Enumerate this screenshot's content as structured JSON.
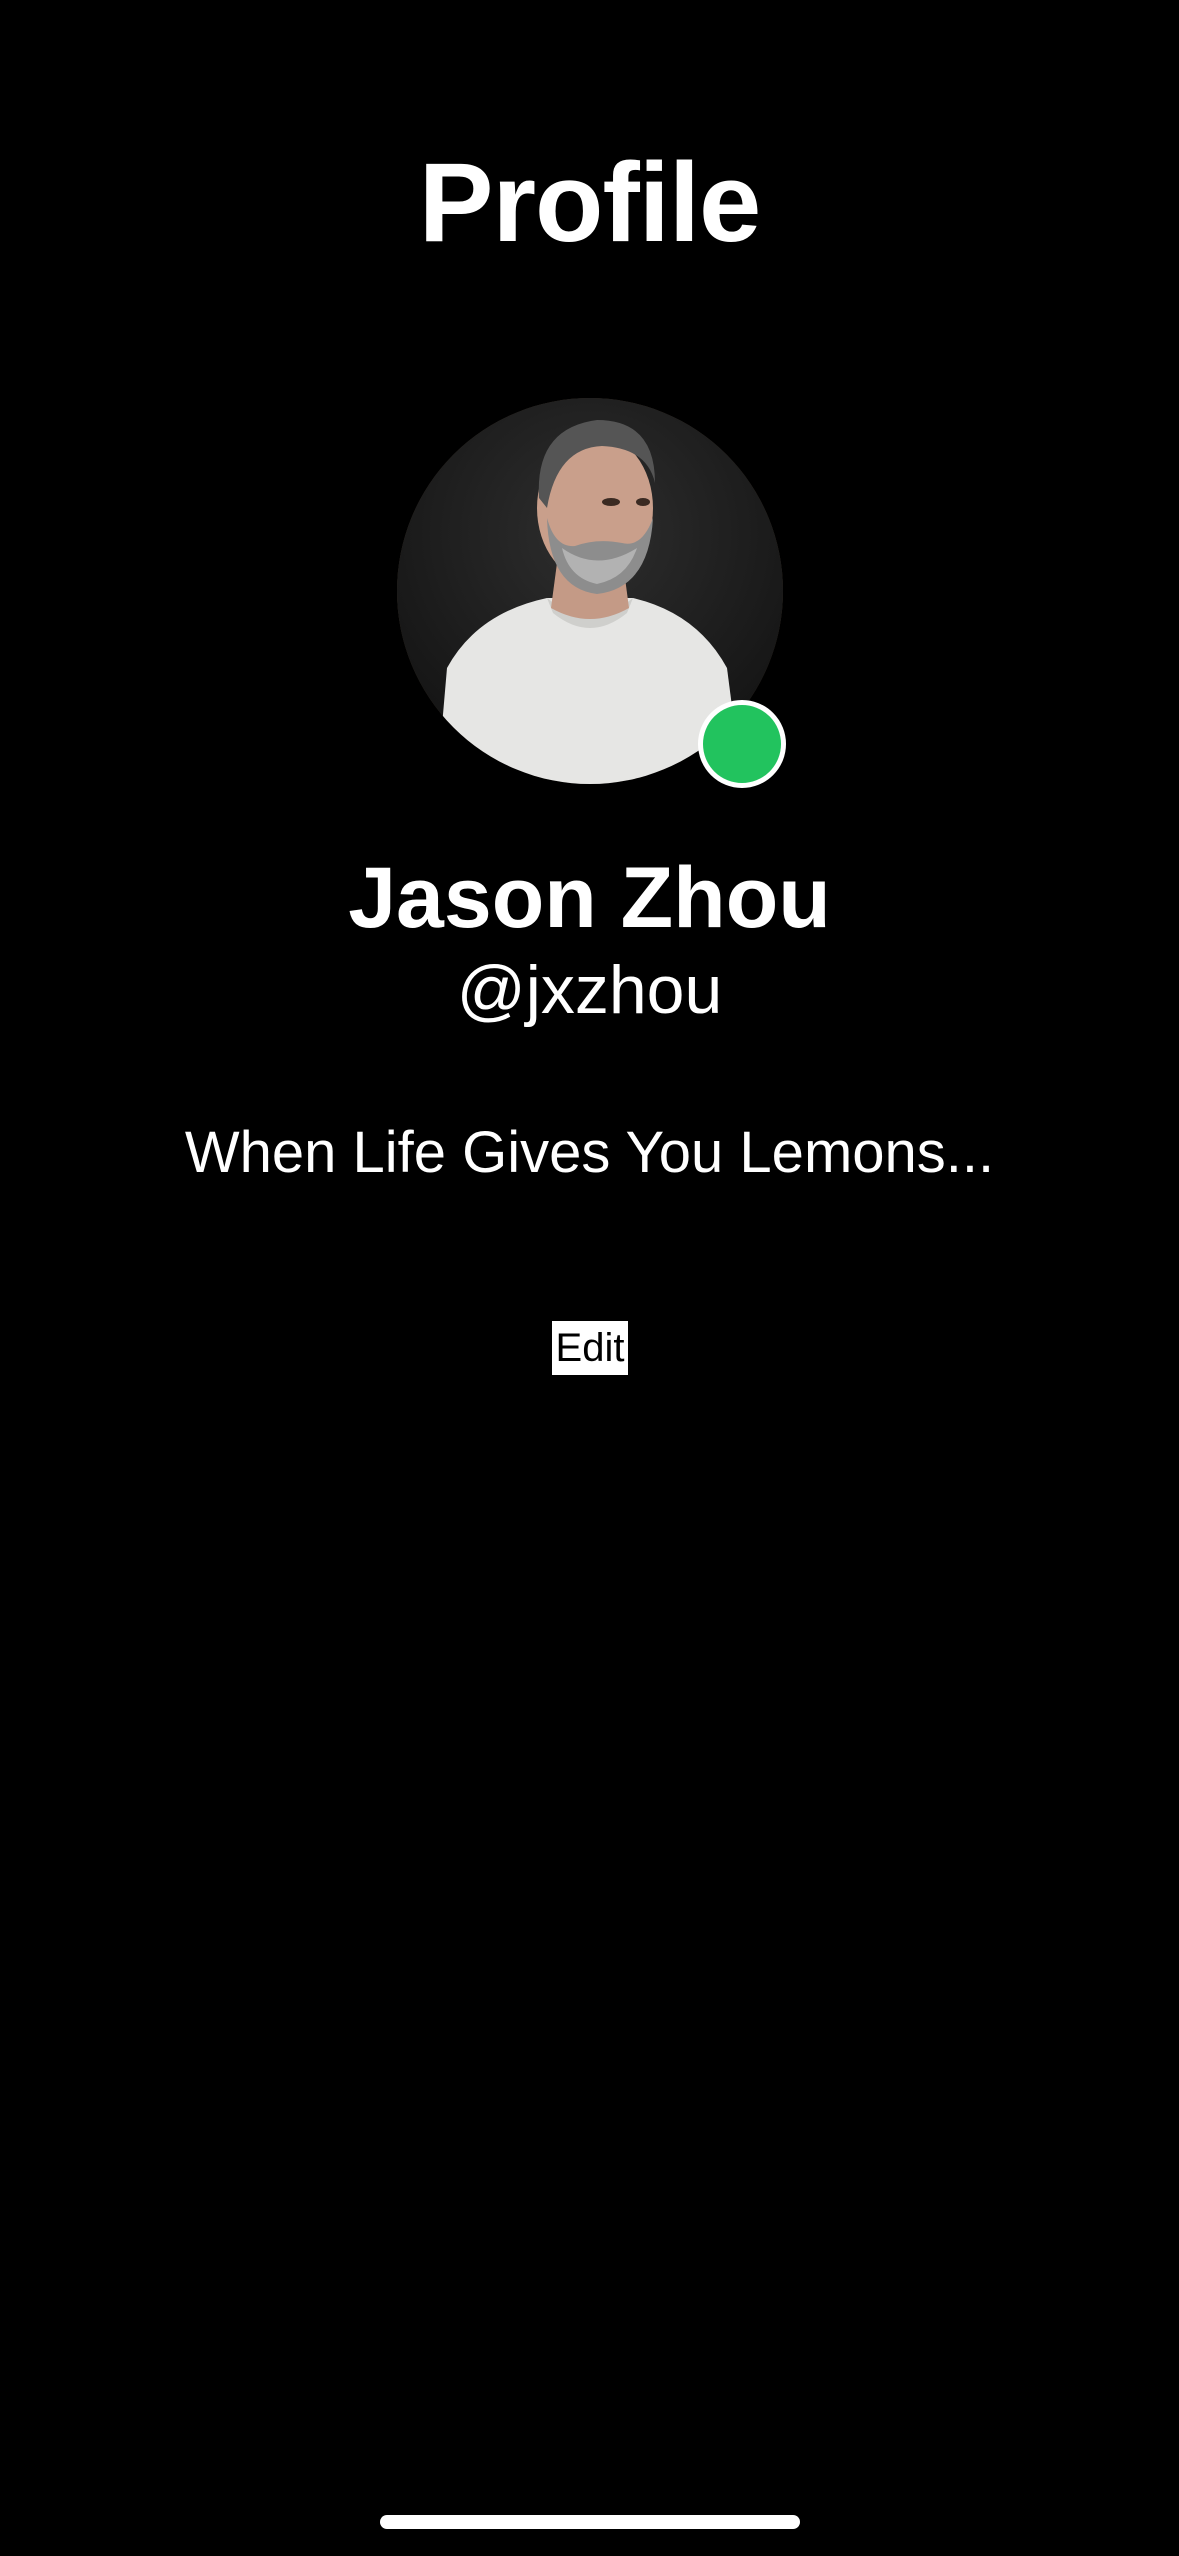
{
  "header": {
    "title": "Profile"
  },
  "profile": {
    "name": "Jason Zhou",
    "handle": "@jxzhou",
    "bio": "When Life Gives You Lemons...",
    "avatar_icon": "avatar-photo",
    "status": "online",
    "status_color": "#22c35e"
  },
  "actions": {
    "edit_label": "Edit"
  }
}
